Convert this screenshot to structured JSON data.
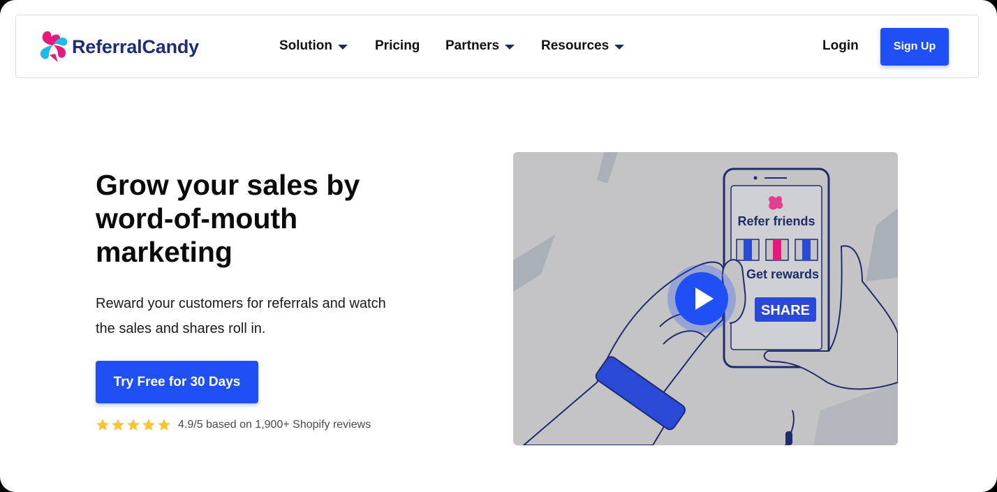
{
  "brand": {
    "name": "ReferralCandy"
  },
  "nav": {
    "items": [
      {
        "label": "Solution",
        "dropdown": true
      },
      {
        "label": "Pricing",
        "dropdown": false
      },
      {
        "label": "Partners",
        "dropdown": true
      },
      {
        "label": "Resources",
        "dropdown": true
      }
    ],
    "login_label": "Login",
    "signup_label": "Sign Up"
  },
  "hero": {
    "title_lines": [
      "Grow your sales by",
      "word-of-mouth",
      "marketing"
    ],
    "subtitle_lines": [
      "Reward your customers for referrals and watch",
      "the sales and shares roll in."
    ],
    "cta_label": "Try Free for 30 Days",
    "rating": {
      "stars": 5,
      "text": "4.9/5 based on 1,900+ Shopify reviews"
    }
  },
  "video": {
    "phone_heading": "Refer friends",
    "phone_subheading": "Get rewards",
    "phone_button": "SHARE",
    "play_icon": "play-icon"
  },
  "colors": {
    "accent": "#1f50f5",
    "brand_navy": "#1d2d7a",
    "star": "#f7c531",
    "video_bg": "#c4c4c6"
  }
}
